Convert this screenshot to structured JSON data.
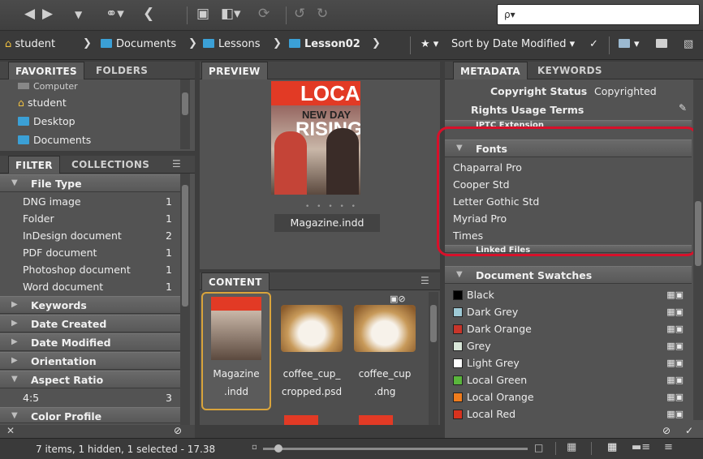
{
  "toolbar": {
    "icons": [
      "back-arrow-icon",
      "forward-arrow-icon",
      "dropdown-icon",
      "recent-folder-icon",
      "return-icon",
      "camera-icon",
      "output-icon",
      "refine-icon",
      "rotate-left-icon",
      "rotate-right-icon"
    ],
    "search_placeholder": "ρ▾"
  },
  "path": {
    "items": [
      {
        "label": "student",
        "icon": "home-icon"
      },
      {
        "label": "Documents",
        "icon": "documents-folder-icon"
      },
      {
        "label": "Lessons",
        "icon": "folder-icon"
      },
      {
        "label": "Lesson02",
        "icon": "folder-icon"
      }
    ],
    "sort_label": "Sort by Date Modified"
  },
  "favorites": {
    "tabs": [
      "FAVORITES",
      "FOLDERS"
    ],
    "items": [
      "Computer",
      "student",
      "Desktop",
      "Documents"
    ]
  },
  "filter": {
    "tabs": [
      "FILTER",
      "COLLECTIONS"
    ],
    "file_type_header": "File Type",
    "file_types": [
      {
        "label": "DNG image",
        "count": "1"
      },
      {
        "label": "Folder",
        "count": "1"
      },
      {
        "label": "InDesign document",
        "count": "2"
      },
      {
        "label": "PDF document",
        "count": "1"
      },
      {
        "label": "Photoshop document",
        "count": "1"
      },
      {
        "label": "Word document",
        "count": "1"
      }
    ],
    "collapsed_sections": [
      "Keywords",
      "Date Created",
      "Date Modified",
      "Orientation"
    ],
    "aspect_ratio_header": "Aspect Ratio",
    "aspect_ratio": {
      "label": "4:5",
      "count": "3"
    },
    "color_profile_header": "Color Profile"
  },
  "preview": {
    "tab": "PREVIEW",
    "filename": "Magazine.indd",
    "cover_title": "LOCAL",
    "cover_sub1": "NEW DAY",
    "cover_sub2": "RISING"
  },
  "content": {
    "tab": "CONTENT",
    "items": [
      {
        "name": "Magazine\n.indd",
        "line1": "Magazine",
        "line2": ".indd"
      },
      {
        "line1": "coffee_cup_",
        "line2": "cropped.psd"
      },
      {
        "line1": "coffee_cup",
        "line2": ".dng"
      }
    ]
  },
  "metadata": {
    "tabs": [
      "METADATA",
      "KEYWORDS"
    ],
    "copyright_status_label": "Copyright Status",
    "copyright_status_value": "Copyrighted",
    "rights_usage_label": "Rights Usage Terms",
    "iptc_label": "IPTC Extension",
    "fonts_header": "Fonts",
    "fonts": [
      "Chaparral Pro",
      "Cooper Std",
      "Letter Gothic Std",
      "Myriad Pro",
      "Times"
    ],
    "linked_files_label": "Linked Files",
    "swatches_header": "Document Swatches",
    "swatches": [
      {
        "label": "Black",
        "color": "#000000"
      },
      {
        "label": "Dark Grey",
        "color": "#9ecad6"
      },
      {
        "label": "Dark Orange",
        "color": "#c8352a"
      },
      {
        "label": "Grey",
        "color": "#d8e6d8"
      },
      {
        "label": "Light Grey",
        "color": "#ffffff"
      },
      {
        "label": "Local Green",
        "color": "#5ab63c"
      },
      {
        "label": "Local Orange",
        "color": "#f07c1c"
      },
      {
        "label": "Local Red",
        "color": "#d8321e"
      }
    ]
  },
  "status": {
    "text": "7 items, 1 hidden, 1 selected - 17.38"
  },
  "colors": {
    "highlight_outline": "#d8102a",
    "selection_border": "#d9a43c",
    "folder_blue": "#3ba0d6"
  }
}
